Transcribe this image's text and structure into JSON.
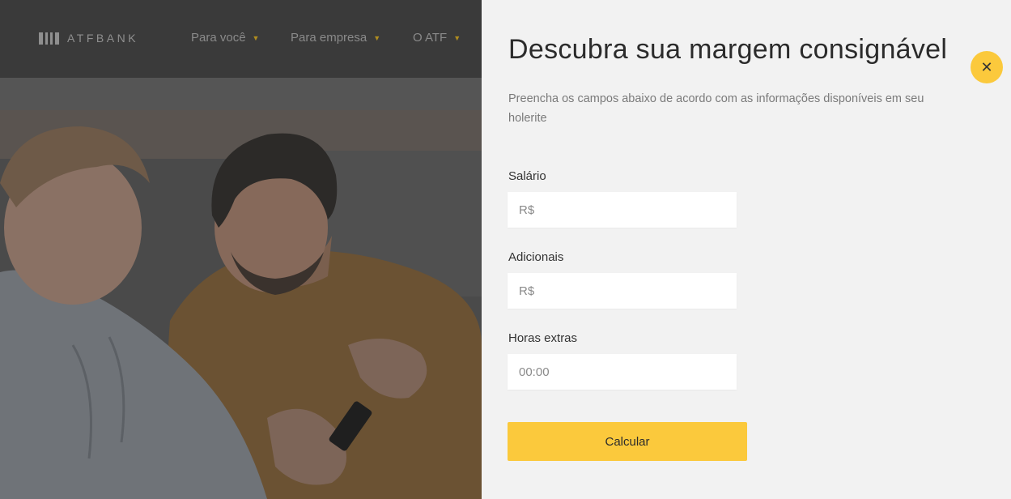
{
  "brand": {
    "name": "ATFBANK",
    "logo_icon": "atf-bars-logo-icon"
  },
  "nav": {
    "items": [
      {
        "label": "Para você",
        "icon": "caret-down-icon"
      },
      {
        "label": "Para empresa",
        "icon": "caret-down-icon"
      },
      {
        "label": "O ATF",
        "icon": "caret-down-icon"
      }
    ],
    "caret": "▼"
  },
  "modal": {
    "title": "Descubra sua margem consignável",
    "description": "Preencha os campos abaixo de acordo com as informações disponíveis em seu holerite",
    "close_label": "✕",
    "fields": [
      {
        "label": "Salário",
        "placeholder": "R$",
        "value": ""
      },
      {
        "label": "Adicionais",
        "placeholder": "R$",
        "value": ""
      },
      {
        "label": "Horas extras",
        "placeholder": "00:00",
        "value": ""
      }
    ],
    "submit_label": "Calcular"
  },
  "colors": {
    "accent": "#fbc93c",
    "navbar": "#3a3a3a",
    "panel_bg": "#f2f2f2",
    "caret": "#b08d1f"
  }
}
